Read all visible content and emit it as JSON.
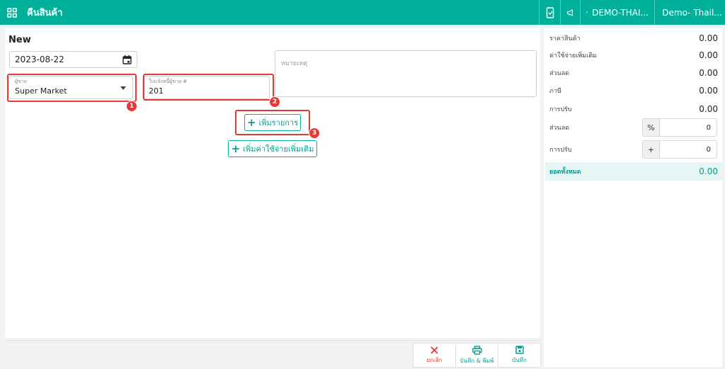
{
  "header": {
    "title": "คืนสินค้า",
    "branch": "DEMO-THAI...",
    "user": "Demo- Thail..."
  },
  "form": {
    "title": "New",
    "date": "2023-08-22",
    "vendor_label": "ผู้ขาย",
    "vendor_value": "Super Market",
    "invoice_label": "ใบแจ้งหนี้ผู้ขาย #",
    "invoice_value": "201",
    "note_placeholder": "หมายเหตุ",
    "add_item_label": "เพิ่มรายการ",
    "add_expense_label": "เพิ่มค่าใช้จ่ายเพิ่มเติม"
  },
  "annotations": [
    "1",
    "2",
    "3"
  ],
  "summary": {
    "rows": [
      {
        "label": "ราคาสินค้า",
        "value": "0.00"
      },
      {
        "label": "ค่าใช้จ่ายเพิ่มเติม",
        "value": "0.00"
      },
      {
        "label": "ส่วนลด",
        "value": "0.00"
      },
      {
        "label": "ภาษี",
        "value": "0.00"
      },
      {
        "label": "การปรับ",
        "value": "0.00"
      }
    ],
    "discount_label": "ส่วนลด",
    "discount_addon": "%",
    "discount_value": "0",
    "adjust_label": "การปรับ",
    "adjust_addon": "+",
    "adjust_value": "0",
    "total_label": "ยอดทั้งหมด",
    "total_value": "0.00"
  },
  "footer": {
    "cancel_label": "ยกเลิก",
    "save_print_label": "บันทึก & พิมพ์",
    "save_label": "บันทึก"
  },
  "colors": {
    "primary": "#00b09b",
    "highlight": "#e53935",
    "total_bg": "#e6f6f4"
  }
}
